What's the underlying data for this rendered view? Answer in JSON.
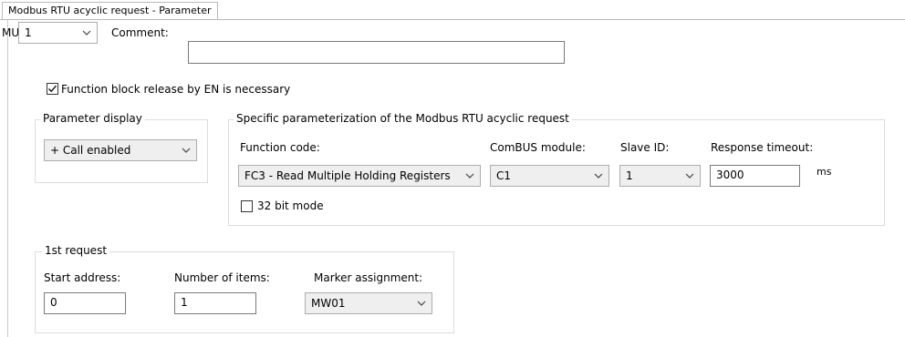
{
  "tab": {
    "label": "Modbus RTU acyclic request - Parameter"
  },
  "mu": {
    "label": "MU:",
    "value": "1"
  },
  "comment": {
    "label": "Comment:",
    "value": ""
  },
  "fb_release": {
    "label": "Function block release by EN is necessary",
    "checked": true
  },
  "parameter_display": {
    "title": "Parameter display",
    "value": "+ Call enabled"
  },
  "specific": {
    "title": "Specific parameterization of the Modbus RTU acyclic request",
    "function_code_label": "Function code:",
    "function_code_value": "FC3 - Read Multiple Holding Registers",
    "combus_label": "ComBUS module:",
    "combus_value": "C1",
    "slave_label": "Slave ID:",
    "slave_value": "1",
    "timeout_label": "Response timeout:",
    "timeout_value": "3000",
    "timeout_unit": "ms",
    "bit_mode_label": "32 bit mode",
    "bit_mode_checked": false
  },
  "request1": {
    "title": "1st request",
    "start_label": "Start address:",
    "start_value": "0",
    "items_label": "Number of items:",
    "items_value": "1",
    "marker_label": "Marker assignment:",
    "marker_value": "MW01"
  },
  "icons": {
    "dropdown": "chevron-down-icon",
    "check": "checkmark-icon"
  },
  "colors": {
    "border": "#adadad",
    "group_border": "#dcdcdc",
    "disabled_bg": "#efefef"
  }
}
